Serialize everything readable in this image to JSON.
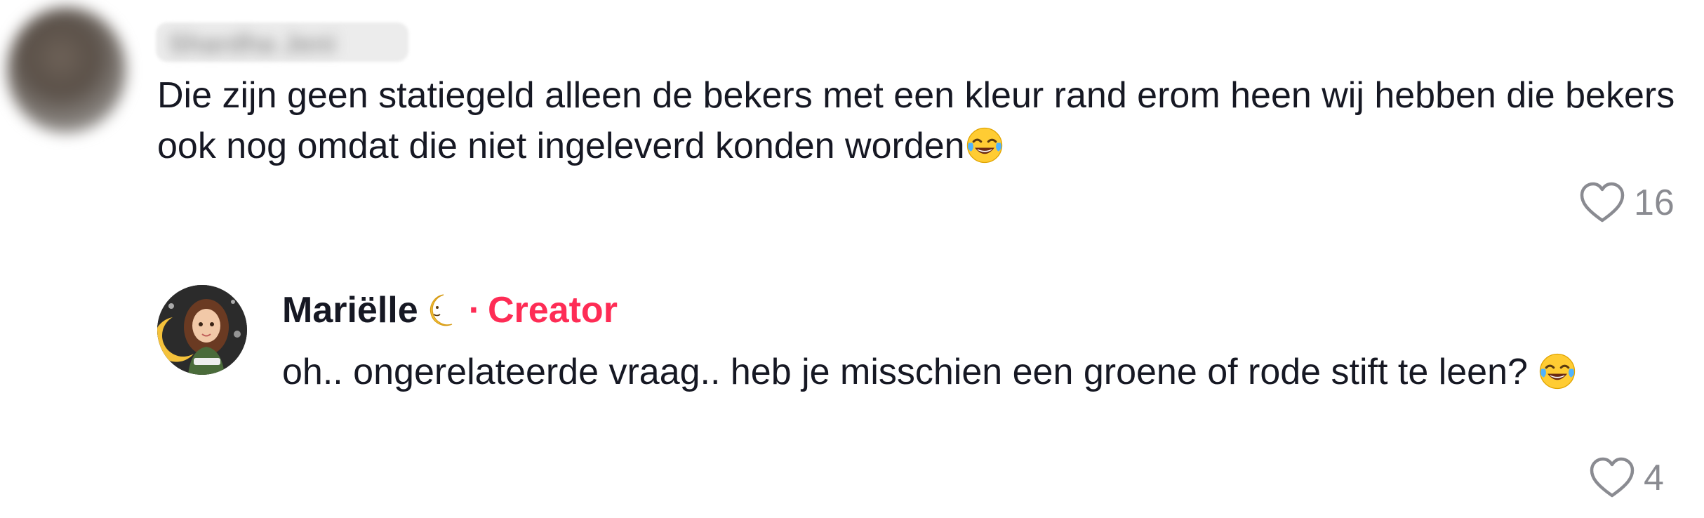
{
  "comment": {
    "username": "Shardha Jeni",
    "text": "Die zijn geen statiegeld alleen de bekers met een kleur rand erom heen wij hebben die bekers ook nog omdat die niet ingeleverd konden worden",
    "emoji": "face-with-tears-of-joy-icon",
    "likes": "16"
  },
  "reply": {
    "username": "Mariëlle",
    "badge_icon": "crescent-moon-icon",
    "separator": "·",
    "creator_label": "Creator",
    "text": "oh.. ongerelateerde vraag.. heb je misschien een groene of rode stift te leen? ",
    "emoji": "face-with-tears-of-joy-icon",
    "likes": "4"
  },
  "colors": {
    "text": "#161823",
    "muted": "#8a8b91",
    "creator": "#fe2c55"
  }
}
